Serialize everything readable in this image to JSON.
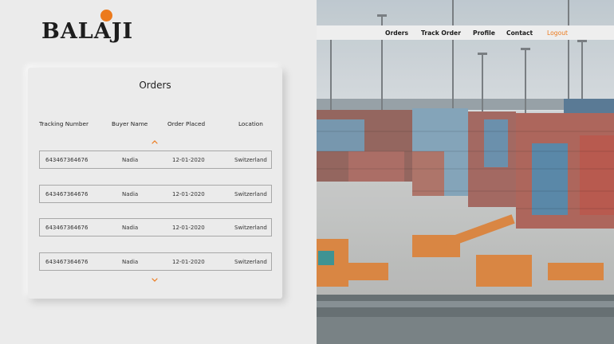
{
  "brand": {
    "name": "BALAJI",
    "accent": "#ec7a1c"
  },
  "nav": {
    "orders": "Orders",
    "track_order": "Track Order",
    "profile": "Profile",
    "contact": "Contact",
    "logout": "Logout"
  },
  "orders": {
    "title": "Orders",
    "headers": [
      "Tracking Number",
      "Buyer Name",
      "Order Placed",
      "Location"
    ],
    "rows": [
      {
        "tracking": "643467364676",
        "buyer": "Nadia",
        "date": "12-01-2020",
        "location": "Switzerland"
      },
      {
        "tracking": "643467364676",
        "buyer": "Nadia",
        "date": "12-01-2020",
        "location": "Switzerland"
      },
      {
        "tracking": "643467364676",
        "buyer": "Nadia",
        "date": "12-01-2020",
        "location": "Switzerland"
      },
      {
        "tracking": "643467364676",
        "buyer": "Nadia",
        "date": "12-01-2020",
        "location": "Switzerland"
      }
    ],
    "scroll_up_icon": "chevron-up-icon",
    "scroll_down_icon": "chevron-down-icon"
  },
  "hero_image": {
    "subject": "shipping-container-port-photo"
  }
}
